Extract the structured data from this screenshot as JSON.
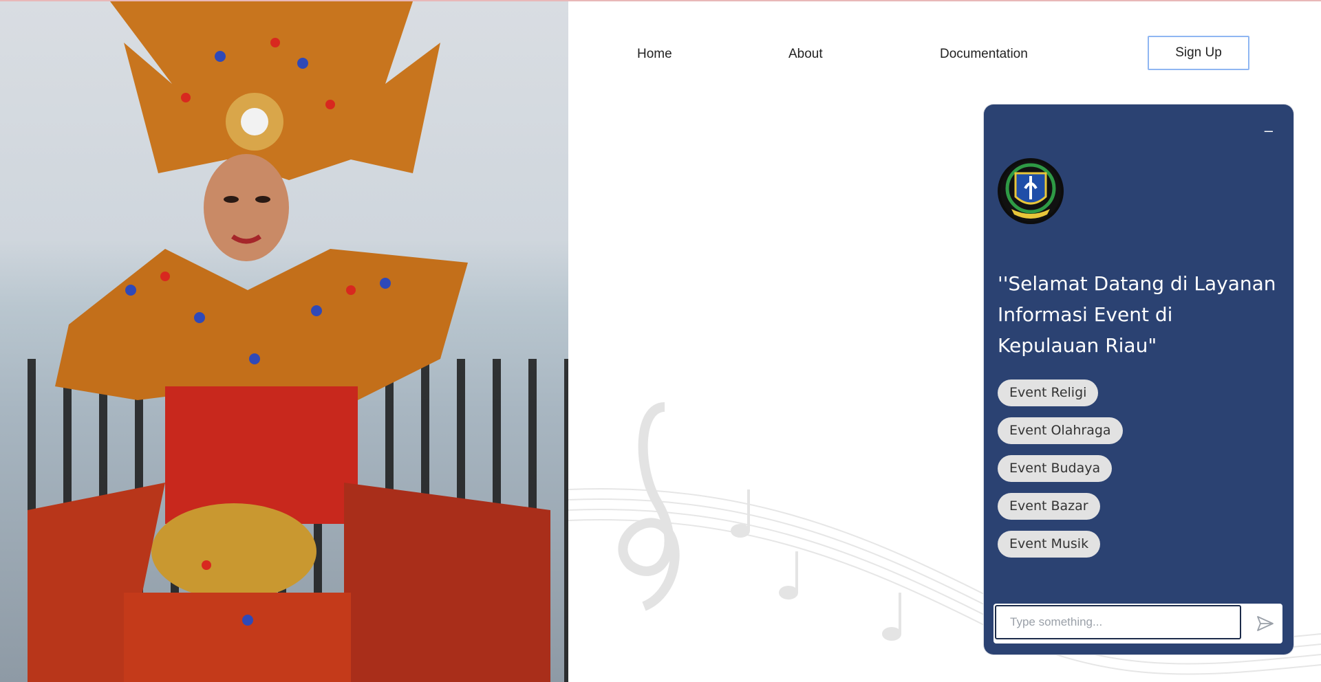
{
  "nav": {
    "links": [
      {
        "label": "Home"
      },
      {
        "label": "About"
      },
      {
        "label": "Documentation"
      }
    ],
    "signup_label": "Sign Up"
  },
  "chat": {
    "minimize_label": "–",
    "welcome_text": "''Selamat Datang di Layanan Informasi Event di Kepulauan Riau\"",
    "chips": [
      {
        "label": "Event Religi"
      },
      {
        "label": "Event Olahraga"
      },
      {
        "label": "Event Budaya"
      },
      {
        "label": "Event Bazar"
      },
      {
        "label": "Event Musik"
      }
    ],
    "input_placeholder": "Type something...",
    "icons": {
      "send": "send-icon",
      "logo": "provincial-emblem-logo"
    }
  },
  "colors": {
    "chat_panel": "#2b4272",
    "signup_border": "#8fb6f2",
    "chip_bg": "#e2e2e2"
  }
}
